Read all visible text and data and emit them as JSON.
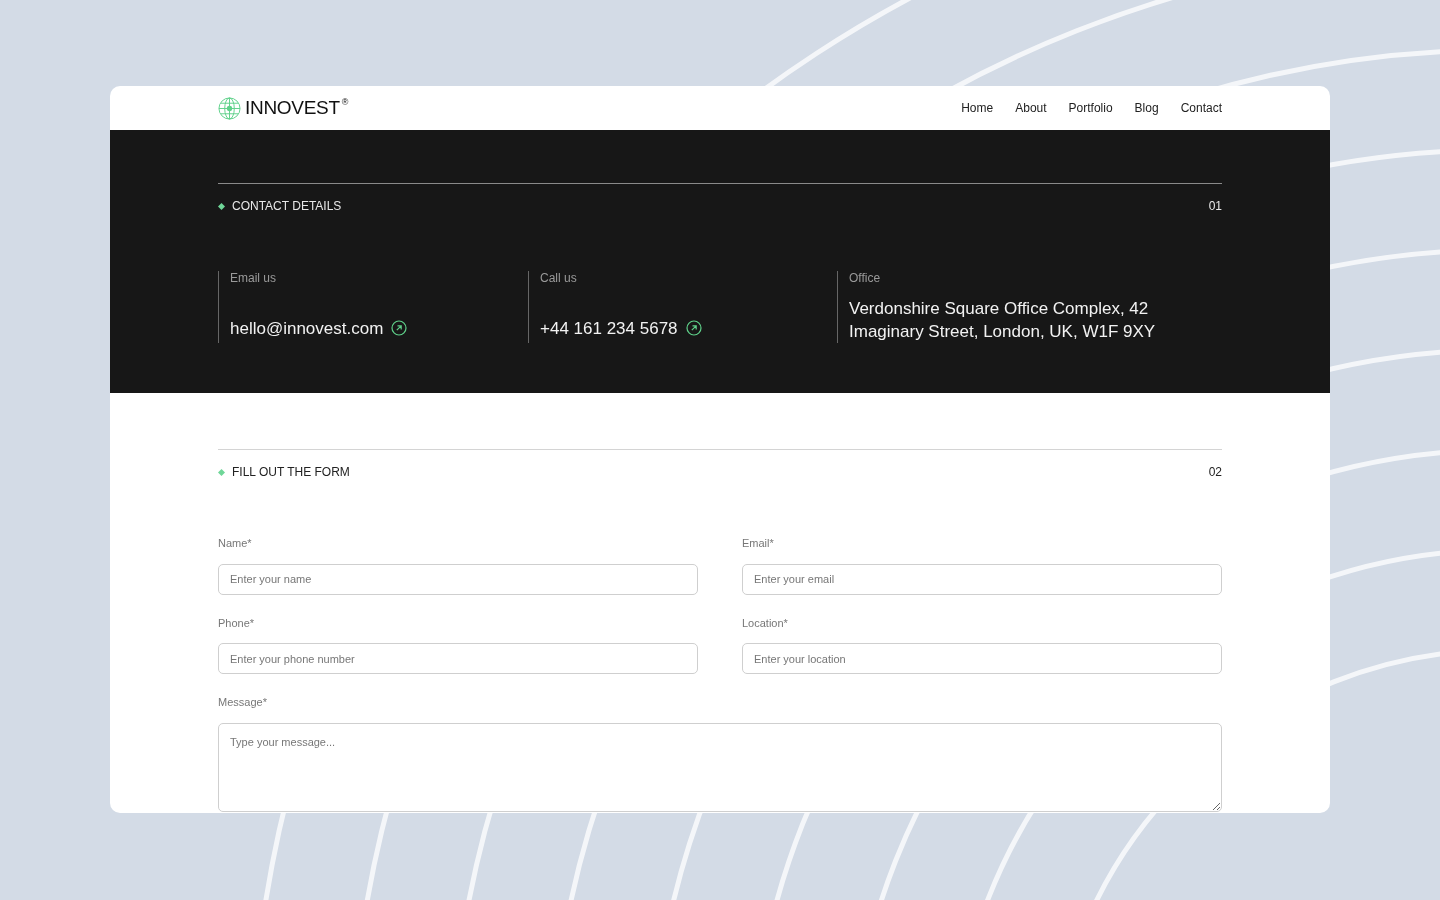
{
  "header": {
    "brand": "INNOVEST",
    "brand_mark": "®",
    "nav": [
      {
        "label": "Home"
      },
      {
        "label": "About"
      },
      {
        "label": "Portfolio"
      },
      {
        "label": "Blog"
      },
      {
        "label": "Contact"
      }
    ]
  },
  "contact_details": {
    "title": "CONTACT DETAILS",
    "number": "01",
    "items": [
      {
        "kind": "email",
        "label": "Email us",
        "value": "hello@innovest.com"
      },
      {
        "kind": "phone",
        "label": "Call us",
        "value": "+44 161 234 5678"
      },
      {
        "kind": "address",
        "label": "Office",
        "value": "Verdonshire Square Office Complex, 42 Imaginary Street, London, UK, W1F 9XY"
      }
    ]
  },
  "form": {
    "title": "FILL OUT THE FORM",
    "number": "02",
    "fields": [
      {
        "kind": "input",
        "label": "Name*",
        "placeholder": "Enter your name"
      },
      {
        "kind": "input",
        "label": "Email*",
        "placeholder": "Enter your email"
      },
      {
        "kind": "input",
        "label": "Phone*",
        "placeholder": "Enter your phone number"
      },
      {
        "kind": "input",
        "label": "Location*",
        "placeholder": "Enter your location"
      },
      {
        "kind": "textarea",
        "label": "Message*",
        "placeholder": "Type your message..."
      }
    ]
  }
}
